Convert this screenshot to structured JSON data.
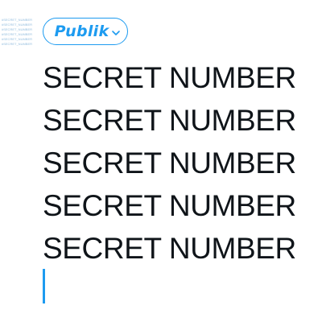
{
  "faint_text": {
    "lines": [
      "#SECRET_NUMBER",
      "#SECRET_NUMBER",
      "#SECRET_NUMBER",
      "#SECRET_NUMBER",
      "#SECRET_NUMBER",
      "#SECRET_NUMBER"
    ]
  },
  "audience": {
    "label": "Publik",
    "icon": "chevron-down-icon",
    "color": "#1d9bf0"
  },
  "compose": {
    "lines": [
      "SECRET NUMBER",
      "SECRET NUMBER",
      "SECRET NUMBER",
      "SECRET NUMBER",
      "SECRET NUMBER"
    ],
    "text_color": "#0f1419",
    "caret_color": "#1d9bf0"
  }
}
